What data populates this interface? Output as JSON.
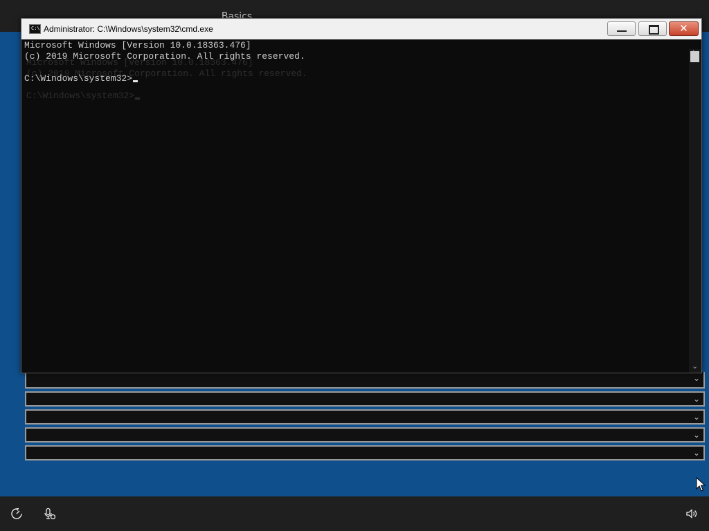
{
  "background": {
    "header_title": "Basics",
    "colors": {
      "oobe_blue": "#0f4f8c",
      "bar": "#1f1f1f"
    },
    "dropdowns": [
      {
        "chevron": "⌄"
      },
      {
        "chevron": "⌄"
      },
      {
        "chevron": "⌄"
      },
      {
        "chevron": "⌄"
      },
      {
        "chevron": "⌄"
      }
    ]
  },
  "cmd_window": {
    "title": "Administrator: C:\\Windows\\system32\\cmd.exe",
    "icon_text": "C:\\",
    "buttons": {
      "minimize": "minimize",
      "maximize": "maximize",
      "close": "✕"
    },
    "console_lines": [
      "Microsoft Windows [Version 10.0.18363.476]",
      "(c) 2019 Microsoft Corporation. All rights reserved.",
      "",
      "C:\\Windows\\system32>"
    ],
    "ghost_lines": [
      "Microsoft Windows [Version 10.0.18363.476]",
      "(c) 2019 Microsoft Corporation. All rights reserved.",
      "",
      "C:\\Windows\\system32>"
    ]
  },
  "taskbar": {
    "icons": [
      "ease-of-access-icon",
      "microphone-icon",
      "volume-icon"
    ]
  }
}
